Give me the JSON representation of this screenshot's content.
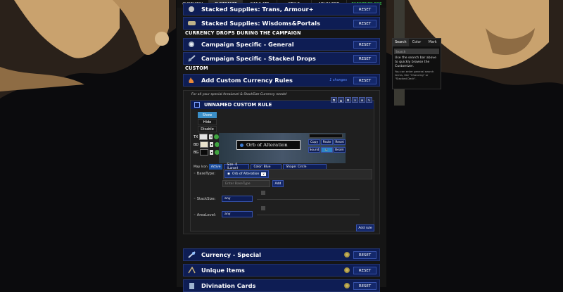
{
  "nav": {
    "tabs": [
      {
        "label": "OVERVIEW"
      },
      {
        "label": "CUSTOMIZE"
      },
      {
        "label": "SIMULATE"
      },
      {
        "label": "STYLE"
      },
      {
        "label": "ADVANCED"
      },
      {
        "label": "EXPORT TO POE"
      }
    ],
    "active_index": 1
  },
  "rows_top": [
    {
      "label": "Stacked Supplies: Trans, Armour+",
      "reset": "RESET"
    },
    {
      "label": "Stacked Supplies: Wisdoms&Portals",
      "reset": "RESET"
    }
  ],
  "sections": {
    "campaign": "CURRENCY DROPS DURING THE CAMPAIGN",
    "custom": "CUSTOM"
  },
  "rows_campaign": [
    {
      "label": "Campaign Specific - General",
      "reset": "RESET"
    },
    {
      "label": "Campaign Specific - Stacked Drops",
      "reset": "RESET"
    }
  ],
  "custom_row": {
    "label": "Add Custom Currency Rules",
    "changes": "1 changes",
    "reset": "RESET"
  },
  "custom_panel": {
    "hint": "For all your special AreaLevel & StackSize Currency needs!",
    "rule_title": "UNNAMED CUSTOM RULE",
    "visibility": [
      "Show",
      "Hide",
      "Disable"
    ],
    "color_rows": [
      "TX",
      "BD",
      "BG"
    ],
    "preview_label": "Orb of Alteration",
    "preview_buttons": [
      "Copy",
      "Paste",
      "Reset",
      "Sound",
      "Beam"
    ],
    "map_icon": {
      "label": "Map Icon",
      "active": "Active",
      "size": "Size: 0 (Large)",
      "color": "Color: Blue",
      "shape": "Shape: Circle"
    },
    "basetype": {
      "label": "BaseType:",
      "chip": "Orb of Alteration",
      "chip_remove": "x",
      "placeholder": "Enter BaseType",
      "add": "Add"
    },
    "stacksize": {
      "label": "StackSize:",
      "value": "any"
    },
    "arealevel": {
      "label": "AreaLevel:",
      "value": "any"
    },
    "add_rule": "Add rule"
  },
  "rows_bottom": [
    {
      "label": "Currency - Special",
      "reset": "RESET"
    },
    {
      "label": "Unique items",
      "reset": "RESET"
    },
    {
      "label": "Divination Cards",
      "reset": "RESET"
    }
  ],
  "help": {
    "tabs": [
      "Search",
      "Color",
      "Mark"
    ],
    "search_placeholder": "Search",
    "text": "Use the search bar above to quickly browse the Customizer.",
    "subtext": "You can enter general search terms, like \"Chancing\" or \"Stacked Deck\"."
  },
  "colors": {
    "row_bg": "#0e1d54",
    "button_bg": "#14286b",
    "show_bg": "#3b8fc8",
    "export": "#39d353"
  }
}
